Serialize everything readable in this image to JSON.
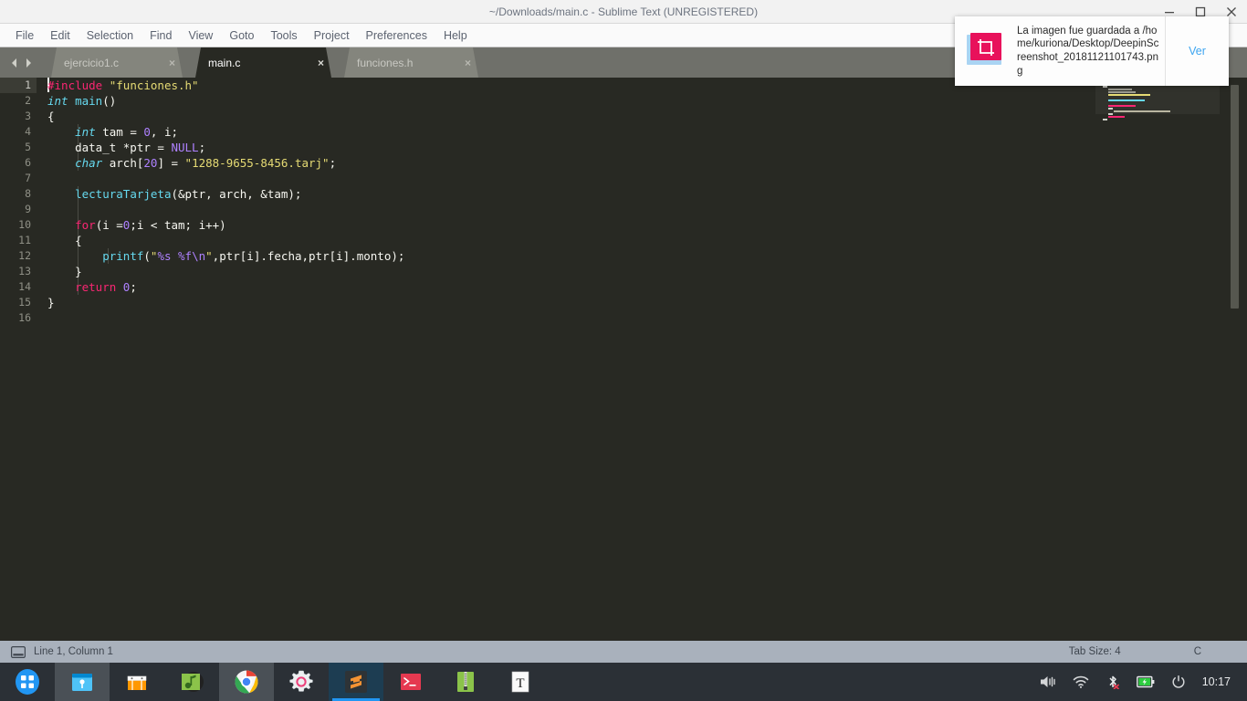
{
  "window": {
    "title": "~/Downloads/main.c - Sublime Text (UNREGISTERED)",
    "controls": {
      "minimize": "minimize-icon",
      "maximize": "maximize-icon",
      "close": "close-icon"
    }
  },
  "menubar": {
    "items": [
      {
        "label": "File"
      },
      {
        "label": "Edit"
      },
      {
        "label": "Selection"
      },
      {
        "label": "Find"
      },
      {
        "label": "View"
      },
      {
        "label": "Goto"
      },
      {
        "label": "Tools"
      },
      {
        "label": "Project"
      },
      {
        "label": "Preferences"
      },
      {
        "label": "Help"
      }
    ]
  },
  "tabs": {
    "items": [
      {
        "label": "ejercicio1.c",
        "active": false,
        "close": "×"
      },
      {
        "label": "main.c",
        "active": true,
        "close": "×"
      },
      {
        "label": "funciones.h",
        "active": false,
        "close": "×"
      }
    ]
  },
  "editor": {
    "line_numbers": [
      "1",
      "2",
      "3",
      "4",
      "5",
      "6",
      "7",
      "8",
      "9",
      "10",
      "11",
      "12",
      "13",
      "14",
      "15",
      "16"
    ],
    "lines": [
      "#include \"funciones.h\"",
      "int main()",
      "{",
      "    int tam = 0, i;",
      "    data_t *ptr = NULL;",
      "    char arch[20] = \"1288-9655-8456.tarj\";",
      "",
      "    lecturaTarjeta(&ptr, arch, &tam);",
      "",
      "    for(i =0;i < tam; i++)",
      "    {",
      "        printf(\"%s %f\\n\",ptr[i].fecha,ptr[i].monto);",
      "    }",
      "    return 0;",
      "}",
      ""
    ],
    "colors": {
      "background": "#282923",
      "foreground": "#f7f7f1",
      "keyword": "#f92672",
      "string": "#e6db74",
      "type": "#66d9ef",
      "function": "#66d9ef",
      "number": "#ae81ff",
      "gutter_text": "#8f9086",
      "active_line_gutter": "#3b3c35"
    }
  },
  "statusbar": {
    "cursor": "Line 1, Column 1",
    "tab_size": "Tab Size: 4",
    "language": "C",
    "left_icon": "window-icon"
  },
  "notification": {
    "icon": "screenshot-crop-icon",
    "message": "La imagen fue guardada a /home/kuriona/Desktop/DeepinScreenshot_20181121101743.png",
    "action_label": "Ver",
    "icon_color": "#e8115b"
  },
  "taskbar": {
    "items": [
      {
        "name": "launcher",
        "icon": "grid-launcher-icon",
        "state": "normal"
      },
      {
        "name": "file-manager",
        "icon": "file-manager-icon",
        "state": "hover"
      },
      {
        "name": "app-store",
        "icon": "store-icon",
        "state": "normal"
      },
      {
        "name": "music-player",
        "icon": "music-note-icon",
        "state": "normal"
      },
      {
        "name": "google-chrome",
        "icon": "chrome-icon",
        "state": "hover"
      },
      {
        "name": "settings",
        "icon": "gear-icon",
        "state": "normal"
      },
      {
        "name": "sublime-text",
        "icon": "sublime-icon",
        "state": "active"
      },
      {
        "name": "terminal",
        "icon": "terminal-icon",
        "state": "normal"
      },
      {
        "name": "archive-manager",
        "icon": "archive-icon",
        "state": "normal"
      },
      {
        "name": "text-editor",
        "icon": "text-t-icon",
        "state": "normal"
      }
    ],
    "tray": {
      "volume": "volume-icon",
      "wifi": "wifi-icon",
      "bluetooth": "bluetooth-off-icon",
      "battery": "battery-charging-icon",
      "power": "power-icon",
      "time": "10:17"
    }
  }
}
